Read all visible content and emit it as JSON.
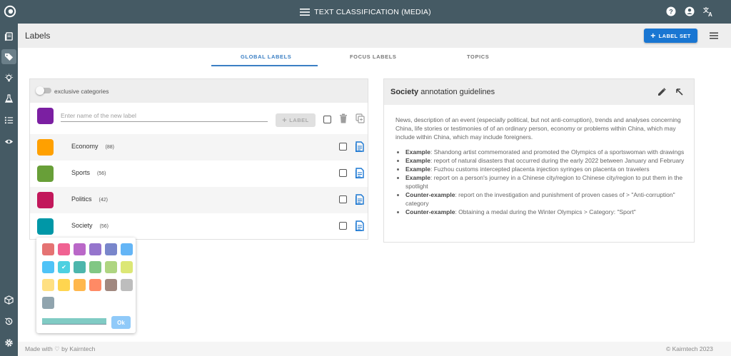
{
  "topbar": {
    "title": "TEXT CLASSIFICATION (MEDIA)",
    "icons": [
      "app-logo-icon",
      "menu-icon",
      "help-icon",
      "account-icon",
      "translate-icon"
    ]
  },
  "rail": {
    "items": [
      "documents-icon",
      "labels-icon",
      "bulb-icon",
      "flask-icon",
      "list-icon",
      "eye-icon",
      "cube-icon",
      "history-icon",
      "settings-icon"
    ],
    "active": "labels-icon"
  },
  "header": {
    "title": "Labels",
    "add_label_set": "LABEL SET"
  },
  "tabs": [
    {
      "label": "GLOBAL LABELS",
      "active": true
    },
    {
      "label": "FOCUS LABELS",
      "active": false
    },
    {
      "label": "TOPICS",
      "active": false
    }
  ],
  "labels_panel": {
    "toggle_label": "exclusive categories",
    "toggle_on": false,
    "new_label": {
      "placeholder": "Enter name of the new label",
      "value": "",
      "color": "#7b1fa2",
      "add_button": "LABEL"
    },
    "labels": [
      {
        "name": "Economy",
        "count": "(88)",
        "color": "#ffa000"
      },
      {
        "name": "Sports",
        "count": "(56)",
        "color": "#689f38"
      },
      {
        "name": "Politics",
        "count": "(42)",
        "color": "#c2185b"
      },
      {
        "name": "Society",
        "count": "(56)",
        "color": "#0097a7"
      }
    ]
  },
  "color_picker": {
    "colors": [
      "#e57373",
      "#f06292",
      "#ba68c8",
      "#9575cd",
      "#7986cb",
      "#64b5f6",
      "#4fc3f7",
      "#4dd0e1",
      "#4db6ac",
      "#81c784",
      "#aed581",
      "#dce775",
      "#ffe082",
      "#ffd54f",
      "#ffb74d",
      "#ff8a65",
      "#a1887f",
      "#bdbdbd",
      "#90a4ae"
    ],
    "selected_index": 7,
    "hex_color": "#80cbc4",
    "ok_label": "Ok"
  },
  "guidelines": {
    "title_bold": "Society",
    "title_rest": " annotation guidelines",
    "description": "News, description of an event (especially political, but not anti-corruption), trends and analyses concerning China, life stories or testimonies of of an ordinary person, economy or problems within China, which may include within China, which may include foreigners.",
    "items": [
      {
        "kind": "Example",
        "text": ": Shandong artist commemorated and promoted the Olympics of a sportswoman with drawings"
      },
      {
        "kind": "Example",
        "text": ": report of natural disasters that occurred during the early 2022 between January and February"
      },
      {
        "kind": "Example",
        "text": ": Fuzhou customs intercepted placenta injection syringes on placenta on travelers"
      },
      {
        "kind": "Example",
        "text": ": report on a person's journey in a Chinese city/region to Chinese city/region to put them in the spotlight"
      },
      {
        "kind": "Counter-example",
        "text": ": report on the investigation and punishment of proven cases of > \"Anti-corruption\" category"
      },
      {
        "kind": "Counter-example",
        "text": ": Obtaining a medal during the Winter Olympics > Category: \"Sport\""
      }
    ]
  },
  "footer": {
    "made_with": "Made with ♡ by Kairntech",
    "copyright": "©   Kairntech 2023"
  }
}
